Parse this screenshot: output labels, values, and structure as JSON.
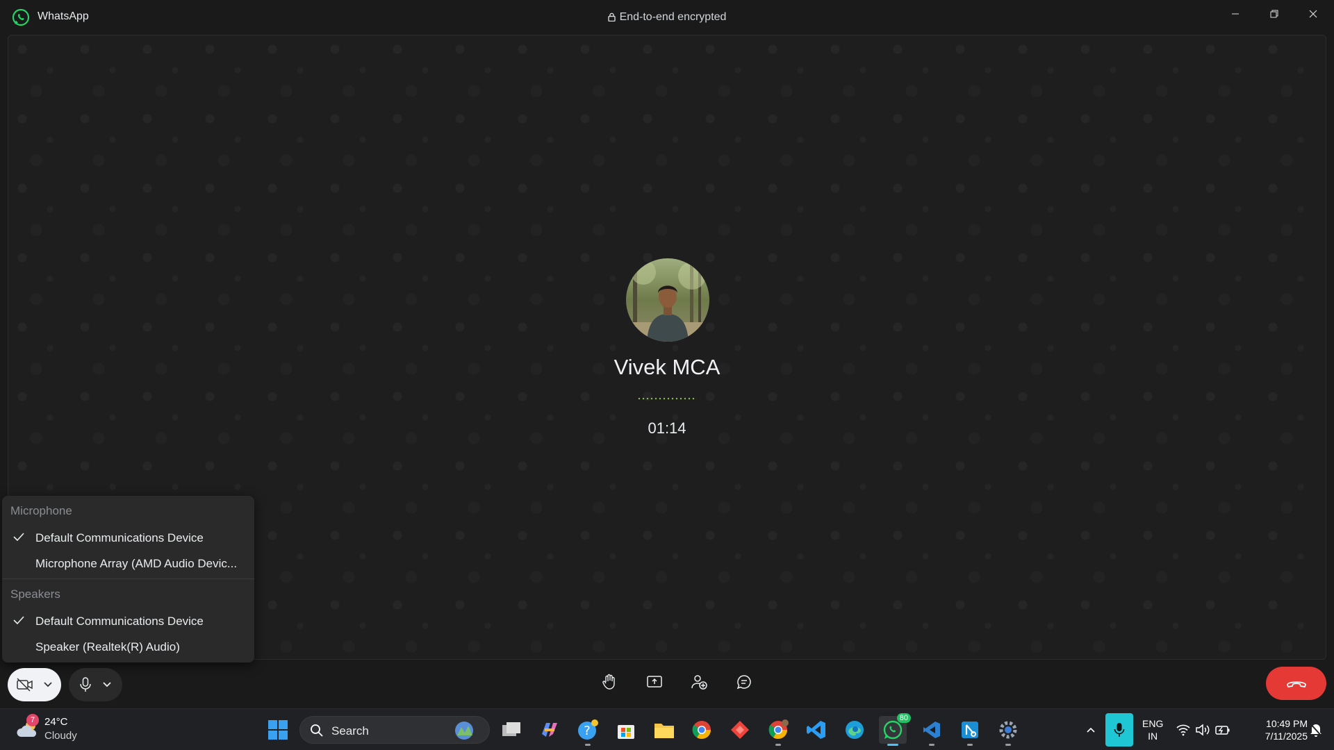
{
  "window": {
    "app_name": "WhatsApp",
    "encryption_notice": "End-to-end encrypted"
  },
  "call": {
    "callee_name": "Vivek MCA",
    "duration": "01:14"
  },
  "device_menu": {
    "microphone_header": "Microphone",
    "microphone_options": [
      {
        "label": "Default Communications Device",
        "selected": true
      },
      {
        "label": "Microphone Array (AMD Audio Devic...",
        "selected": false
      }
    ],
    "speakers_header": "Speakers",
    "speaker_options": [
      {
        "label": "Default Communications Device",
        "selected": true
      },
      {
        "label": "Speaker (Realtek(R) Audio)",
        "selected": false
      }
    ]
  },
  "taskbar": {
    "weather": {
      "badge": "7",
      "temperature": "24°C",
      "condition": "Cloudy"
    },
    "search_label": "Search",
    "whatsapp_badge": "80",
    "language": {
      "line1": "ENG",
      "line2": "IN"
    },
    "clock": {
      "time": "10:49 PM",
      "date": "7/11/2025"
    }
  },
  "colors": {
    "end_call": "#e53935",
    "accent_green": "#25d366",
    "tray_mic": "#1fc7d4"
  }
}
